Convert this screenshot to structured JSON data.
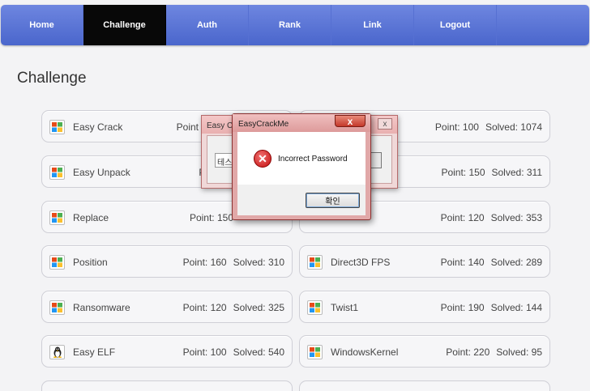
{
  "nav": {
    "items": [
      {
        "label": "Home"
      },
      {
        "label": "Challenge"
      },
      {
        "label": "Auth"
      },
      {
        "label": "Rank"
      },
      {
        "label": "Link"
      },
      {
        "label": "Logout"
      },
      {
        "label": ""
      }
    ],
    "active_index": 1
  },
  "page": {
    "title": "Challenge"
  },
  "challenges": {
    "left": [
      {
        "name": "Easy Crack",
        "point": "Point",
        "solved": "",
        "icon": "windows-icon"
      },
      {
        "name": "Easy Unpack",
        "point": "Po",
        "solved": "",
        "icon": "windows-icon"
      },
      {
        "name": "Replace",
        "point": "Point: 150",
        "solved": "",
        "icon": "windows-icon"
      },
      {
        "name": "Position",
        "point": "Point: 160",
        "solved": "Solved: 310",
        "icon": "windows-icon"
      },
      {
        "name": "Ransomware",
        "point": "Point: 120",
        "solved": "Solved: 325",
        "icon": "windows-icon"
      },
      {
        "name": "Easy ELF",
        "point": "Point: 100",
        "solved": "Solved: 540",
        "icon": "linux-icon"
      }
    ],
    "right": [
      {
        "name": "",
        "point": "Point: 100",
        "solved": "Solved: 1074",
        "icon": ""
      },
      {
        "name": "",
        "point": "Point: 150",
        "solved": "Solved: 311",
        "icon": ""
      },
      {
        "name": "",
        "point": "Point: 120",
        "solved": "Solved: 353",
        "icon": ""
      },
      {
        "name": "Direct3D FPS",
        "point": "Point: 140",
        "solved": "Solved: 289",
        "icon": "windows-icon"
      },
      {
        "name": "Twist1",
        "point": "Point: 190",
        "solved": "Solved: 144",
        "icon": "windows-icon"
      },
      {
        "name": "WindowsKernel",
        "point": "Point: 220",
        "solved": "Solved: 95",
        "icon": "windows-icon"
      }
    ]
  },
  "back_dialog": {
    "title": "Easy Cra",
    "input_value": "테스",
    "close_label": "x"
  },
  "error_dialog": {
    "title": "EasyCrackMe",
    "close_label": "x",
    "message": "Incorrect Password",
    "icon": "error-icon",
    "ok_label": "확인"
  },
  "colors": {
    "nav_bg": "#5a74d8",
    "nav_active": "#080808",
    "error_red": "#c41010"
  }
}
